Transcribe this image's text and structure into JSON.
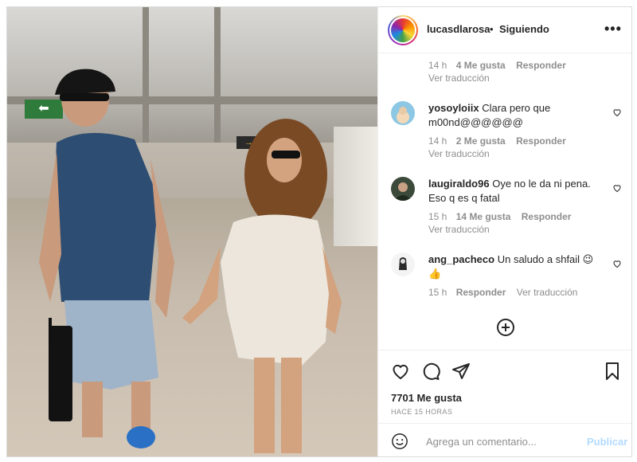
{
  "post": {
    "username": "lucasdlarosa",
    "separator": "•",
    "follow_status": "Siguiendo",
    "more_label": "•••"
  },
  "comments": [
    {
      "username": "",
      "text": "",
      "meta": {
        "time": "14 h",
        "likes": "4 Me gusta",
        "reply": "Responder"
      },
      "translation": "Ver traducción"
    },
    {
      "username": "yosoyloiix",
      "text": "Clara pero que m00nd@@@@@@",
      "meta": {
        "time": "14 h",
        "likes": "2 Me gusta",
        "reply": "Responder"
      },
      "translation": "Ver traducción"
    },
    {
      "username": "laugiraldo96",
      "text": "Oye no le da ni pena. Eso q es q fatal",
      "meta": {
        "time": "15 h",
        "likes": "14 Me gusta",
        "reply": "Responder"
      },
      "translation": "Ver traducción"
    },
    {
      "username": "ang_pacheco",
      "text": "Un saludo a shfail 😉 👍",
      "meta": {
        "time": "15 h",
        "likes": "",
        "reply": "Responder"
      },
      "translation": "Ver traducción"
    }
  ],
  "actions": {
    "likes": "7701 Me gusta",
    "time_ago": "HACE 15 HORAS"
  },
  "composer": {
    "placeholder": "Agrega un comentario...",
    "publish_label": "Publicar"
  },
  "icons": {
    "emoji": "emoji-icon",
    "heart": "heart-icon",
    "comment": "comment-icon",
    "share": "share-icon",
    "save": "bookmark-icon",
    "add": "add-circle-icon",
    "sign_exit": "⬅ exit sign",
    "sign_gate": "→ ◆"
  },
  "colors": {
    "publish": "#b3dbff",
    "meta": "#8e8e8e",
    "text": "#262626"
  }
}
